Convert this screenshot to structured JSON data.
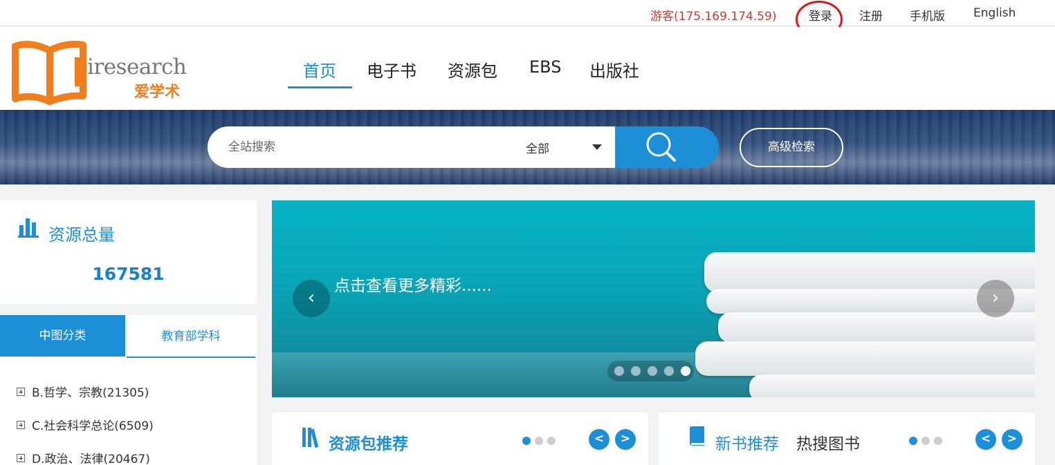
{
  "topbar": {
    "guest": "游客(175.169.174.59)",
    "login": "登录",
    "register": "注册",
    "mobile": "手机版",
    "english": "English"
  },
  "logo": {
    "word": "iresearch",
    "cn": "爱学术"
  },
  "nav": [
    "首页",
    "电子书",
    "资源包",
    "EBS",
    "出版社"
  ],
  "search": {
    "placeholder": "全站搜索",
    "scope": "全部",
    "advanced": "高级检索"
  },
  "stats": {
    "title": "资源总量",
    "total": "167581"
  },
  "classification": {
    "tabs": [
      "中图分类",
      "教育部学科"
    ],
    "items": [
      "B.哲学、宗教(21305)",
      "C.社会科学总论(6509)",
      "D.政治、法律(20467)"
    ]
  },
  "carousel": {
    "caption": "点击查看更多精彩......",
    "prev": "‹",
    "next": "›",
    "dot_count": 5,
    "active_dot": 5
  },
  "panels": {
    "packages": {
      "title": "资源包推荐",
      "prev": "<",
      "next": ">",
      "dot_count": 3,
      "active_dot": 1
    },
    "newbooks": {
      "title": "新书推荐",
      "alt_title": "热搜图书",
      "prev": "<",
      "next": ">",
      "dot_count": 3,
      "active_dot": 1
    }
  },
  "colors": {
    "accent": "#1c8fd6",
    "guest": "#d03a34",
    "logo_orange": "#f07d1e",
    "annotation": "#e0141b"
  }
}
